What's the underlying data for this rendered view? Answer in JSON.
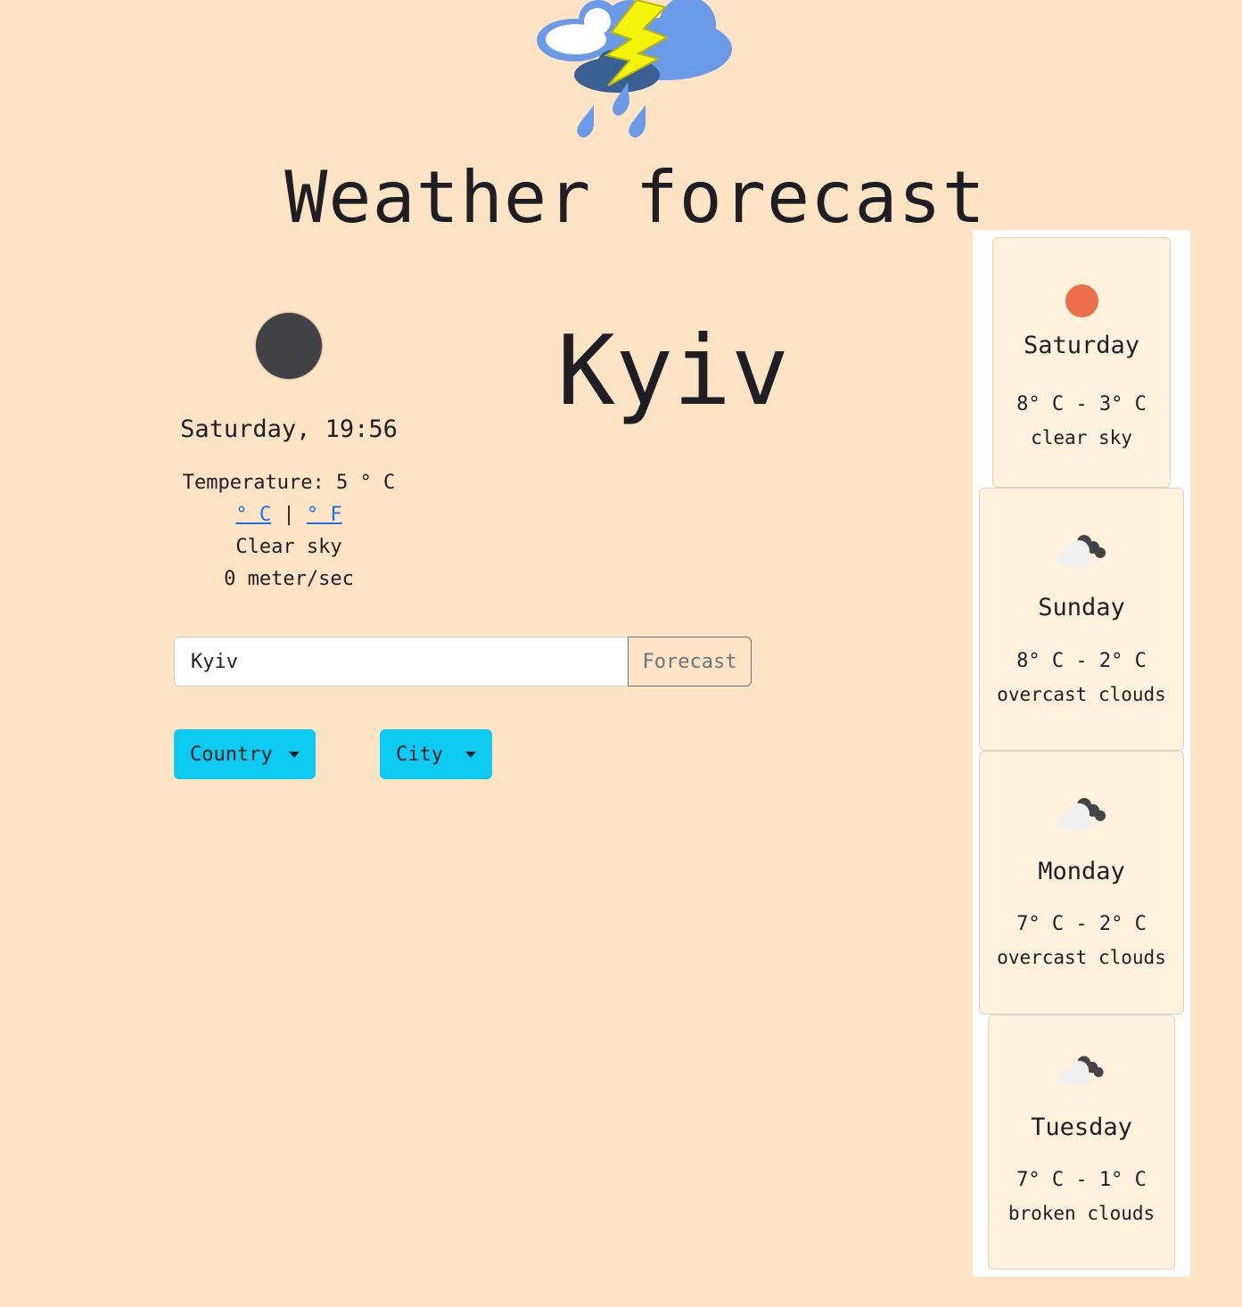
{
  "header": {
    "logo_icon": "thunderstorm-rain-icon",
    "title": "Weather forecast"
  },
  "current": {
    "icon": "moon-icon",
    "icon_color": "#434247",
    "city": "Kyiv",
    "datetime": "Saturday, 19:56",
    "temperature_label": "Temperature:",
    "temperature_value": "5",
    "temperature_unit": "° C",
    "unit_celsius_label": "° C",
    "unit_separator": "|",
    "unit_fahrenheit_label": "° F",
    "description": "Clear sky",
    "wind": "0 meter/sec"
  },
  "search": {
    "value": "Kyiv",
    "button_label": "Forecast"
  },
  "filters": {
    "country_label": "Country",
    "city_label": "City",
    "button_color": "#0dcaf0"
  },
  "forecast": [
    {
      "day": "Saturday",
      "range": "8° C - 3° C",
      "condition": "clear sky",
      "icon": "sun-icon"
    },
    {
      "day": "Sunday",
      "range": "8° C - 2° C",
      "condition": "overcast clouds",
      "icon": "cloud-icon"
    },
    {
      "day": "Monday",
      "range": "7° C - 2° C",
      "condition": "overcast clouds",
      "icon": "cloud-icon"
    },
    {
      "day": "Tuesday",
      "range": "7° C - 1° C",
      "condition": "broken clouds",
      "icon": "cloud-icon"
    }
  ],
  "colors": {
    "background": "#fee4c4",
    "card_background": "#fff2dc",
    "link": "#1a6fe6",
    "sun": "#ec6e4c"
  }
}
